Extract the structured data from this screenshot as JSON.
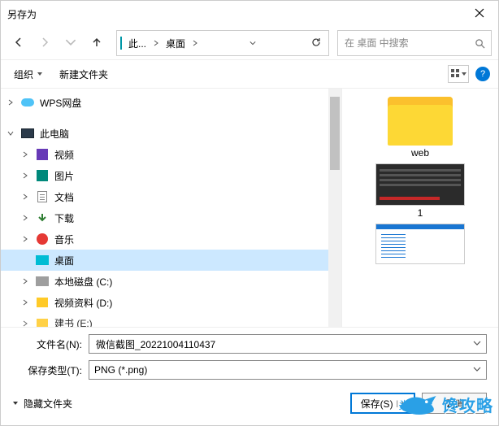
{
  "title": "另存为",
  "nav": {
    "crumbs": [
      "此...",
      "桌面"
    ],
    "search_placeholder": "在 桌面 中搜索"
  },
  "toolbar": {
    "organize": "组织",
    "new_folder": "新建文件夹",
    "help": "?"
  },
  "tree": [
    {
      "kind": "wps",
      "label": "WPS网盘",
      "expandable": true,
      "expanded": false,
      "indent": 0
    },
    {
      "kind": "pc",
      "label": "此电脑",
      "expandable": true,
      "expanded": true,
      "indent": 0
    },
    {
      "kind": "video",
      "label": "视频",
      "expandable": true,
      "expanded": false,
      "indent": 1
    },
    {
      "kind": "pic",
      "label": "图片",
      "expandable": true,
      "expanded": false,
      "indent": 1
    },
    {
      "kind": "doc",
      "label": "文档",
      "expandable": true,
      "expanded": false,
      "indent": 1
    },
    {
      "kind": "dl",
      "label": "下载",
      "expandable": true,
      "expanded": false,
      "indent": 1
    },
    {
      "kind": "music",
      "label": "音乐",
      "expandable": true,
      "expanded": false,
      "indent": 1
    },
    {
      "kind": "desk",
      "label": "桌面",
      "expandable": false,
      "expanded": false,
      "indent": 1,
      "selected": true
    },
    {
      "kind": "disk",
      "label": "本地磁盘 (C:)",
      "expandable": true,
      "expanded": false,
      "indent": 1
    },
    {
      "kind": "folder",
      "label": "视频资料 (D:)",
      "expandable": true,
      "expanded": false,
      "indent": 1
    },
    {
      "kind": "folder",
      "label": "建书 (E:)",
      "expandable": true,
      "expanded": false,
      "indent": 1,
      "cut": true
    }
  ],
  "preview": [
    {
      "type": "folder",
      "label": "web"
    },
    {
      "type": "thumb1",
      "label": "1"
    },
    {
      "type": "thumb2",
      "label": ""
    }
  ],
  "form": {
    "filename_label": "文件名(N):",
    "filename_value": "微信截图_20221004110437",
    "filetype_label": "保存类型(T):",
    "filetype_value": "PNG (*.png)"
  },
  "footer": {
    "hide_folders": "隐藏文件夹",
    "save": "保存(S)",
    "cancel": "取消"
  },
  "watermark": {
    "text": "馋攻略",
    "extra": "头@ 傻"
  }
}
